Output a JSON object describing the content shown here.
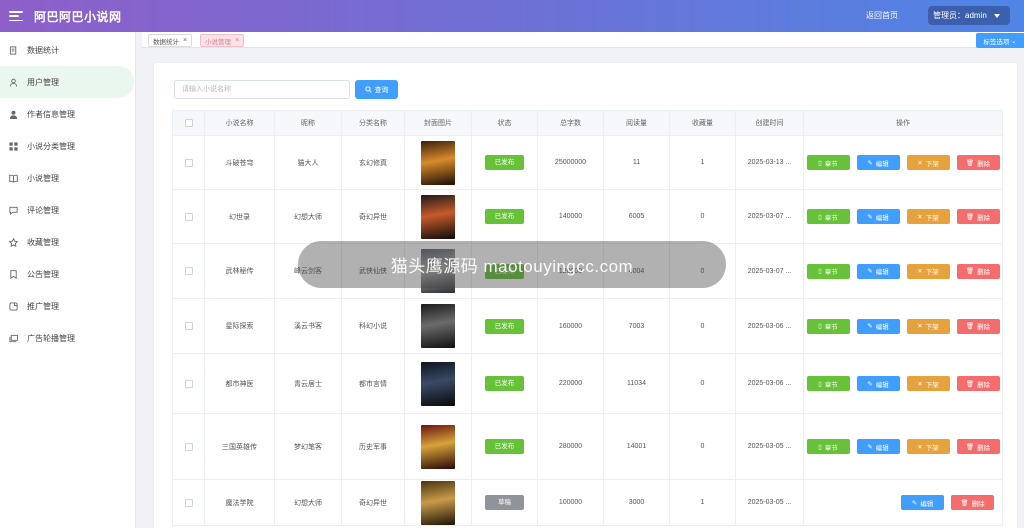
{
  "app": {
    "title": "阿巴阿巴小说网",
    "home_link": "返回首页",
    "admin_label": "管理员：admin"
  },
  "sidebar": {
    "items": [
      {
        "label": "数据统计",
        "icon": "document-icon"
      },
      {
        "label": "用户管理",
        "icon": "user-icon",
        "active": true
      },
      {
        "label": "作者信息管理",
        "icon": "author-icon"
      },
      {
        "label": "小说分类管理",
        "icon": "grid-icon"
      },
      {
        "label": "小说管理",
        "icon": "book-icon"
      },
      {
        "label": "评论管理",
        "icon": "comment-icon"
      },
      {
        "label": "收藏管理",
        "icon": "star-icon"
      },
      {
        "label": "公告管理",
        "icon": "bookmark-icon"
      },
      {
        "label": "推广管理",
        "icon": "promo-icon"
      },
      {
        "label": "广告轮播管理",
        "icon": "carousel-icon"
      }
    ]
  },
  "tabs": [
    {
      "label": "数据统计",
      "active": false
    },
    {
      "label": "小说管理",
      "active": true
    }
  ],
  "tab_options": "标签选项",
  "search": {
    "placeholder": "请输入小说名称",
    "button": "查询"
  },
  "table": {
    "headers": [
      "小说名称",
      "昵称",
      "分类名称",
      "封面图片",
      "状态",
      "总字数",
      "阅读量",
      "收藏量",
      "创建时间",
      "操作"
    ],
    "buttons": {
      "chapter": "章节",
      "edit": "编辑",
      "offline": "下架",
      "delete": "删除"
    },
    "rows": [
      {
        "name": "斗破苍穹",
        "author": "猫大人",
        "category": "玄幻修真",
        "status": "已发布",
        "words": "25000000",
        "reads": "11",
        "favs": "1",
        "created": "2025-03-13 ...",
        "cover": [
          "#3a1f0c",
          "#d98a2a",
          "#1a0f05"
        ]
      },
      {
        "name": "幻世录",
        "author": "幻想大师",
        "category": "奇幻异世",
        "status": "已发布",
        "words": "140000",
        "reads": "6005",
        "favs": "0",
        "created": "2025-03-07 ...",
        "cover": [
          "#1d1a1a",
          "#c75a2a",
          "#0c0c0c"
        ]
      },
      {
        "name": "武林秘传",
        "author": "峰云剑客",
        "category": "武侠仙侠",
        "status": "已发布",
        "words": "120000",
        "reads": "4004",
        "favs": "0",
        "created": "2025-03-07 ...",
        "cover": [
          "#5a6270",
          "#a9a9a9",
          "#2b2f36"
        ]
      },
      {
        "name": "星际探索",
        "author": "溪云书客",
        "category": "科幻小说",
        "status": "已发布",
        "words": "160000",
        "reads": "7003",
        "favs": "0",
        "created": "2025-03-06 ...",
        "cover": [
          "#1a1a1a",
          "#6b6b6b",
          "#101010"
        ]
      },
      {
        "name": "都市神医",
        "author": "青云居士",
        "category": "都市言情",
        "status": "已发布",
        "words": "220000",
        "reads": "11034",
        "favs": "0",
        "created": "2025-03-06 ...",
        "cover": [
          "#0e1420",
          "#3a4a66",
          "#0a0a0a"
        ]
      },
      {
        "name": "三国英雄传",
        "author": "梦幻笔客",
        "category": "历史军事",
        "status": "已发布",
        "words": "280000",
        "reads": "14001",
        "favs": "0",
        "created": "2025-03-05 ...",
        "cover": [
          "#6a1410",
          "#d6a23a",
          "#2a0808"
        ]
      },
      {
        "name": "魔法学院",
        "author": "幻想大师",
        "category": "奇幻异世",
        "status": "草稿",
        "words": "100000",
        "reads": "3000",
        "favs": "1",
        "created": "2025-03-05 ...",
        "cover": [
          "#4a3210",
          "#c89a4a",
          "#1d1406"
        ]
      }
    ]
  },
  "colors": {
    "published": "#67c23a",
    "draft": "#909399",
    "primary": "#409eff"
  },
  "watermark_text": "猫头鹰源码 maotouyingcc.com"
}
